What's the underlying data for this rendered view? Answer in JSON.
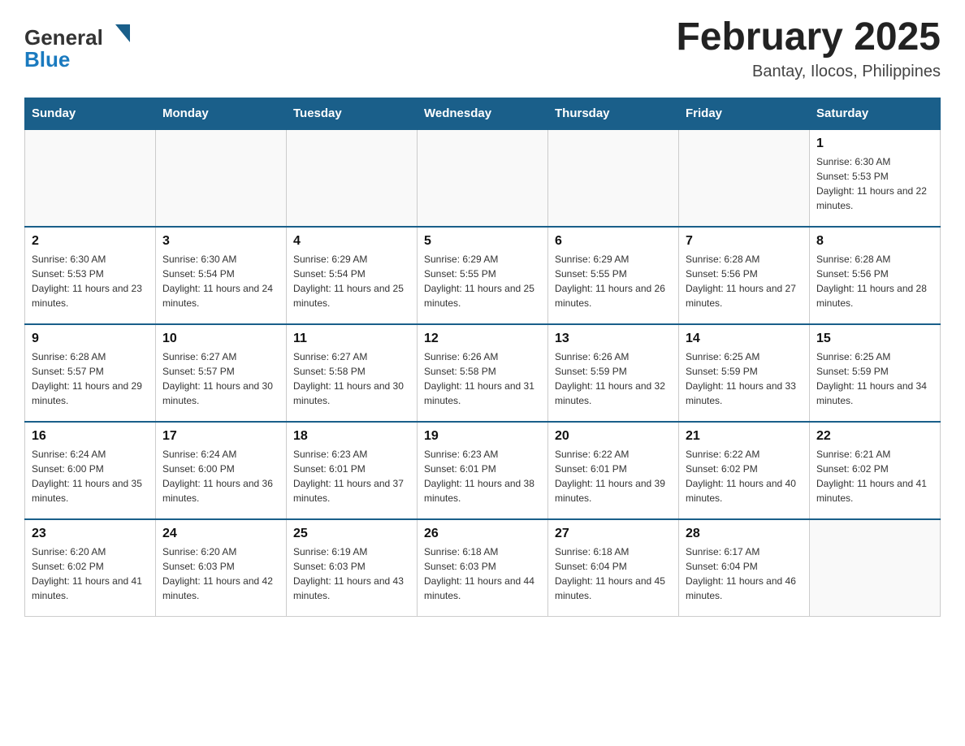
{
  "header": {
    "logo_general": "General",
    "logo_blue": "Blue",
    "month_title": "February 2025",
    "location": "Bantay, Ilocos, Philippines"
  },
  "weekdays": [
    "Sunday",
    "Monday",
    "Tuesday",
    "Wednesday",
    "Thursday",
    "Friday",
    "Saturday"
  ],
  "weeks": [
    [
      {
        "day": "",
        "sunrise": "",
        "sunset": "",
        "daylight": ""
      },
      {
        "day": "",
        "sunrise": "",
        "sunset": "",
        "daylight": ""
      },
      {
        "day": "",
        "sunrise": "",
        "sunset": "",
        "daylight": ""
      },
      {
        "day": "",
        "sunrise": "",
        "sunset": "",
        "daylight": ""
      },
      {
        "day": "",
        "sunrise": "",
        "sunset": "",
        "daylight": ""
      },
      {
        "day": "",
        "sunrise": "",
        "sunset": "",
        "daylight": ""
      },
      {
        "day": "1",
        "sunrise": "Sunrise: 6:30 AM",
        "sunset": "Sunset: 5:53 PM",
        "daylight": "Daylight: 11 hours and 22 minutes."
      }
    ],
    [
      {
        "day": "2",
        "sunrise": "Sunrise: 6:30 AM",
        "sunset": "Sunset: 5:53 PM",
        "daylight": "Daylight: 11 hours and 23 minutes."
      },
      {
        "day": "3",
        "sunrise": "Sunrise: 6:30 AM",
        "sunset": "Sunset: 5:54 PM",
        "daylight": "Daylight: 11 hours and 24 minutes."
      },
      {
        "day": "4",
        "sunrise": "Sunrise: 6:29 AM",
        "sunset": "Sunset: 5:54 PM",
        "daylight": "Daylight: 11 hours and 25 minutes."
      },
      {
        "day": "5",
        "sunrise": "Sunrise: 6:29 AM",
        "sunset": "Sunset: 5:55 PM",
        "daylight": "Daylight: 11 hours and 25 minutes."
      },
      {
        "day": "6",
        "sunrise": "Sunrise: 6:29 AM",
        "sunset": "Sunset: 5:55 PM",
        "daylight": "Daylight: 11 hours and 26 minutes."
      },
      {
        "day": "7",
        "sunrise": "Sunrise: 6:28 AM",
        "sunset": "Sunset: 5:56 PM",
        "daylight": "Daylight: 11 hours and 27 minutes."
      },
      {
        "day": "8",
        "sunrise": "Sunrise: 6:28 AM",
        "sunset": "Sunset: 5:56 PM",
        "daylight": "Daylight: 11 hours and 28 minutes."
      }
    ],
    [
      {
        "day": "9",
        "sunrise": "Sunrise: 6:28 AM",
        "sunset": "Sunset: 5:57 PM",
        "daylight": "Daylight: 11 hours and 29 minutes."
      },
      {
        "day": "10",
        "sunrise": "Sunrise: 6:27 AM",
        "sunset": "Sunset: 5:57 PM",
        "daylight": "Daylight: 11 hours and 30 minutes."
      },
      {
        "day": "11",
        "sunrise": "Sunrise: 6:27 AM",
        "sunset": "Sunset: 5:58 PM",
        "daylight": "Daylight: 11 hours and 30 minutes."
      },
      {
        "day": "12",
        "sunrise": "Sunrise: 6:26 AM",
        "sunset": "Sunset: 5:58 PM",
        "daylight": "Daylight: 11 hours and 31 minutes."
      },
      {
        "day": "13",
        "sunrise": "Sunrise: 6:26 AM",
        "sunset": "Sunset: 5:59 PM",
        "daylight": "Daylight: 11 hours and 32 minutes."
      },
      {
        "day": "14",
        "sunrise": "Sunrise: 6:25 AM",
        "sunset": "Sunset: 5:59 PM",
        "daylight": "Daylight: 11 hours and 33 minutes."
      },
      {
        "day": "15",
        "sunrise": "Sunrise: 6:25 AM",
        "sunset": "Sunset: 5:59 PM",
        "daylight": "Daylight: 11 hours and 34 minutes."
      }
    ],
    [
      {
        "day": "16",
        "sunrise": "Sunrise: 6:24 AM",
        "sunset": "Sunset: 6:00 PM",
        "daylight": "Daylight: 11 hours and 35 minutes."
      },
      {
        "day": "17",
        "sunrise": "Sunrise: 6:24 AM",
        "sunset": "Sunset: 6:00 PM",
        "daylight": "Daylight: 11 hours and 36 minutes."
      },
      {
        "day": "18",
        "sunrise": "Sunrise: 6:23 AM",
        "sunset": "Sunset: 6:01 PM",
        "daylight": "Daylight: 11 hours and 37 minutes."
      },
      {
        "day": "19",
        "sunrise": "Sunrise: 6:23 AM",
        "sunset": "Sunset: 6:01 PM",
        "daylight": "Daylight: 11 hours and 38 minutes."
      },
      {
        "day": "20",
        "sunrise": "Sunrise: 6:22 AM",
        "sunset": "Sunset: 6:01 PM",
        "daylight": "Daylight: 11 hours and 39 minutes."
      },
      {
        "day": "21",
        "sunrise": "Sunrise: 6:22 AM",
        "sunset": "Sunset: 6:02 PM",
        "daylight": "Daylight: 11 hours and 40 minutes."
      },
      {
        "day": "22",
        "sunrise": "Sunrise: 6:21 AM",
        "sunset": "Sunset: 6:02 PM",
        "daylight": "Daylight: 11 hours and 41 minutes."
      }
    ],
    [
      {
        "day": "23",
        "sunrise": "Sunrise: 6:20 AM",
        "sunset": "Sunset: 6:02 PM",
        "daylight": "Daylight: 11 hours and 41 minutes."
      },
      {
        "day": "24",
        "sunrise": "Sunrise: 6:20 AM",
        "sunset": "Sunset: 6:03 PM",
        "daylight": "Daylight: 11 hours and 42 minutes."
      },
      {
        "day": "25",
        "sunrise": "Sunrise: 6:19 AM",
        "sunset": "Sunset: 6:03 PM",
        "daylight": "Daylight: 11 hours and 43 minutes."
      },
      {
        "day": "26",
        "sunrise": "Sunrise: 6:18 AM",
        "sunset": "Sunset: 6:03 PM",
        "daylight": "Daylight: 11 hours and 44 minutes."
      },
      {
        "day": "27",
        "sunrise": "Sunrise: 6:18 AM",
        "sunset": "Sunset: 6:04 PM",
        "daylight": "Daylight: 11 hours and 45 minutes."
      },
      {
        "day": "28",
        "sunrise": "Sunrise: 6:17 AM",
        "sunset": "Sunset: 6:04 PM",
        "daylight": "Daylight: 11 hours and 46 minutes."
      },
      {
        "day": "",
        "sunrise": "",
        "sunset": "",
        "daylight": ""
      }
    ]
  ]
}
